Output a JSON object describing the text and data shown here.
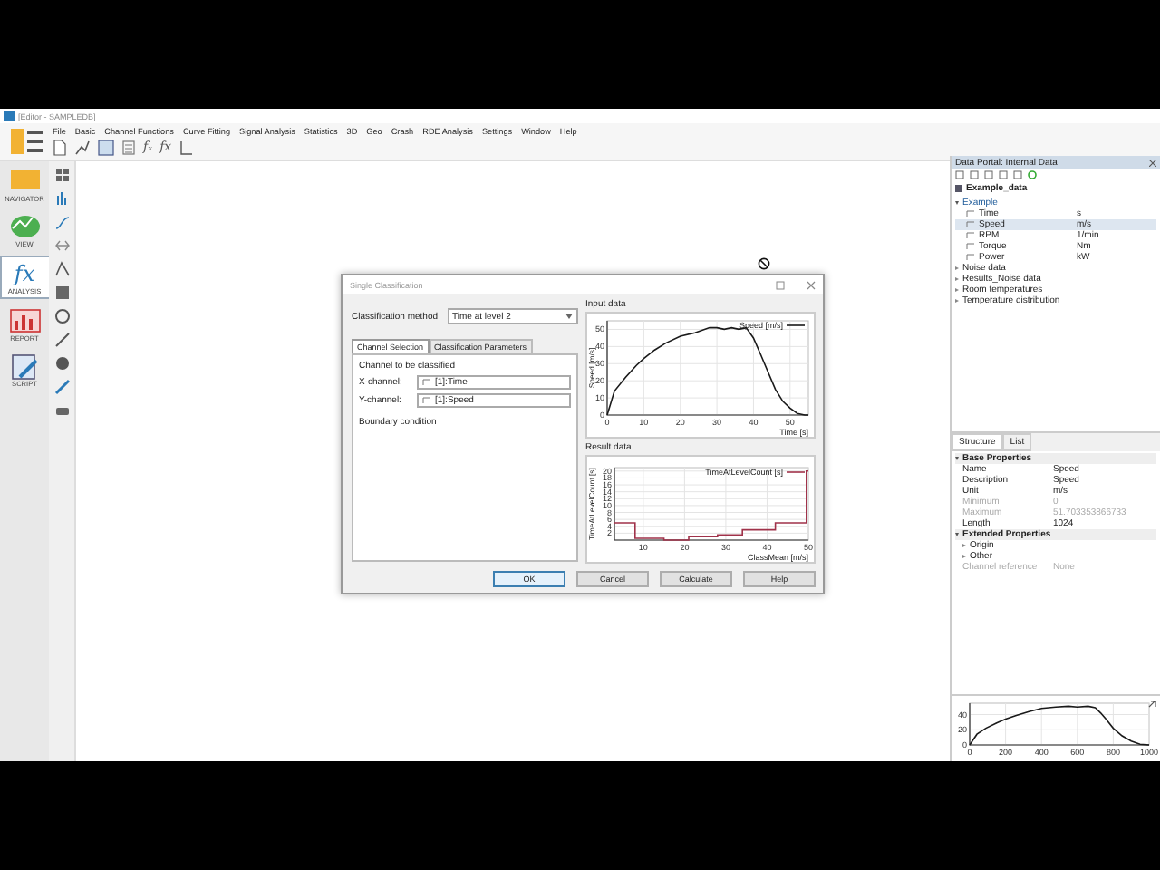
{
  "window": {
    "title": "[Editor - SAMPLEDB]"
  },
  "menu": [
    "File",
    "Basic",
    "Channel Functions",
    "Curve Fitting",
    "Signal Analysis",
    "Statistics",
    "3D",
    "Geo",
    "Crash",
    "RDE Analysis",
    "Settings",
    "Window",
    "Help"
  ],
  "toolbar": {
    "glyphs": [
      "fₓ",
      "fx"
    ]
  },
  "navigator": [
    {
      "label": "NAVIGATOR",
      "selected": false
    },
    {
      "label": "VIEW",
      "selected": false
    },
    {
      "label": "ANALYSIS",
      "selected": true,
      "glyph": "fx"
    },
    {
      "label": "REPORT",
      "selected": false
    },
    {
      "label": "SCRIPT",
      "selected": false
    }
  ],
  "dialog": {
    "title": "Single Classification",
    "method_label": "Classification method",
    "method_value": "Time at level 2",
    "tabs": [
      {
        "label": "Channel Selection",
        "selected": true
      },
      {
        "label": "Classification Parameters",
        "selected": false
      }
    ],
    "group_label": "Channel to be classified",
    "fields": [
      {
        "label": "X-channel:",
        "value": "[1]:Time"
      },
      {
        "label": "Y-channel:",
        "value": "[1]:Speed"
      }
    ],
    "boundary_label": "Boundary condition",
    "input_title": "Input data",
    "input_chart": {
      "chart_data": {
        "type": "line",
        "grid": true,
        "xlabel": "Time [s]",
        "ylabel": "Speed [m/s]",
        "xlim": [
          0,
          55
        ],
        "ylim": [
          0,
          55
        ],
        "xticks": [
          0,
          10,
          20,
          30,
          40,
          50
        ],
        "yticks": [
          0,
          10,
          20,
          30,
          40,
          50
        ],
        "x": [
          0,
          2,
          5,
          8,
          10,
          13,
          16,
          20,
          24,
          28,
          30,
          32,
          34,
          36,
          38,
          40,
          42,
          44,
          46,
          48,
          50,
          52,
          54,
          55
        ],
        "series": [
          {
            "name": "Speed [m/s]",
            "color": "#1a1a1a",
            "values": [
              0,
              14,
              22,
              29,
              33,
              38,
              42,
              46,
              48,
              51,
              51,
              50,
              51,
              50,
              51,
              45,
              35,
              25,
              15,
              8,
              4,
              1,
              0,
              0
            ]
          }
        ]
      }
    },
    "result_title": "Result data",
    "result_chart": {
      "chart_data": {
        "type": "line",
        "grid": true,
        "xlabel": "ClassMean [m/s]",
        "ylabel": "TimeAtLevelCount [s]",
        "xlim": [
          3,
          50
        ],
        "ylim": [
          0,
          21
        ],
        "xticks": [
          10,
          20,
          30,
          40,
          50
        ],
        "yticks": [
          2,
          4,
          6,
          8,
          10,
          12,
          14,
          16,
          18,
          20
        ],
        "x": [
          3,
          8,
          8,
          15,
          15,
          21,
          21,
          28,
          28,
          34,
          34,
          42,
          42,
          49.5,
          49.5,
          50
        ],
        "series": [
          {
            "name": "TimeAtLevelCount [s]",
            "color": "#a0324a",
            "values": [
              5,
              5,
              0.5,
              0.5,
              0,
              0,
              1,
              1,
              1.5,
              1.5,
              3,
              3,
              5,
              5,
              20,
              20
            ]
          }
        ]
      }
    },
    "buttons": [
      "OK",
      "Cancel",
      "Calculate",
      "Help"
    ]
  },
  "data_panel": {
    "title": "Data Portal: Internal Data",
    "file": "Example_data",
    "groups": [
      {
        "label": "Example",
        "expanded": true,
        "children": [
          {
            "name": "Time",
            "unit": "s",
            "selected": false
          },
          {
            "name": "Speed",
            "unit": "m/s",
            "selected": true
          },
          {
            "name": "RPM",
            "unit": "1/min",
            "selected": false
          },
          {
            "name": "Torque",
            "unit": "Nm",
            "selected": false
          },
          {
            "name": "Power",
            "unit": "kW",
            "selected": false
          }
        ]
      },
      {
        "label": "Noise data",
        "expanded": false
      },
      {
        "label": "Results_Noise data",
        "expanded": false
      },
      {
        "label": "Room temperatures",
        "expanded": false
      },
      {
        "label": "Temperature distribution",
        "expanded": false
      }
    ]
  },
  "properties": {
    "tabs": [
      {
        "label": "Structure",
        "selected": true
      },
      {
        "label": "List",
        "selected": false
      }
    ],
    "sections": [
      {
        "label": "Base Properties",
        "rows": [
          {
            "kind": "prop",
            "name": "Name",
            "value": "Speed",
            "disabled": false
          },
          {
            "kind": "prop",
            "name": "Description",
            "value": "Speed",
            "disabled": false
          },
          {
            "kind": "prop",
            "name": "Unit",
            "value": "m/s",
            "disabled": false
          },
          {
            "kind": "prop",
            "name": "Minimum",
            "value": "0",
            "disabled": true
          },
          {
            "kind": "prop",
            "name": "Maximum",
            "value": "51.703353866733",
            "disabled": true
          },
          {
            "kind": "prop",
            "name": "Length",
            "value": "1024",
            "disabled": false
          }
        ]
      },
      {
        "label": "Extended Properties",
        "rows": [
          {
            "kind": "group",
            "name": "Origin"
          },
          {
            "kind": "group",
            "name": "Other"
          },
          {
            "kind": "prop",
            "name": "Channel reference",
            "value": "None",
            "disabled": true
          }
        ]
      }
    ]
  },
  "preview": {
    "chart_data": {
      "type": "line",
      "grid": true,
      "xlim": [
        0,
        1000
      ],
      "ylim": [
        0,
        55
      ],
      "xticks": [
        0,
        200,
        400,
        600,
        800,
        1000
      ],
      "yticks": [
        0,
        20,
        40
      ],
      "x": [
        0,
        40,
        90,
        150,
        200,
        260,
        330,
        400,
        480,
        550,
        600,
        660,
        700,
        730,
        760,
        800,
        850,
        900,
        950,
        1000
      ],
      "series": [
        {
          "color": "#1a1a1a",
          "values": [
            0,
            14,
            22,
            29,
            34,
            39,
            44,
            48,
            50,
            51,
            50,
            51,
            49,
            42,
            34,
            22,
            12,
            5,
            1,
            0
          ]
        }
      ]
    }
  }
}
